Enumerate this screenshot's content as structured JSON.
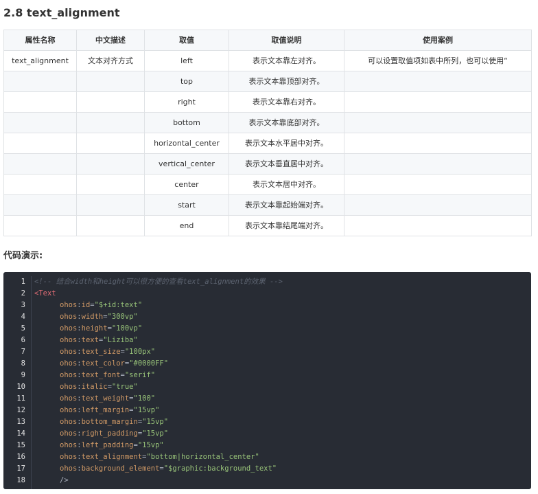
{
  "section_title": "2.8 text_alignment",
  "table": {
    "headers": [
      "属性名称",
      "中文描述",
      "取值",
      "取值说明",
      "使用案例"
    ],
    "rows": [
      [
        "text_alignment",
        "文本对齐方式",
        "left",
        "表示文本靠左对齐。",
        "可以设置取值项如表中所列，也可以使用“"
      ],
      [
        "",
        "",
        "top",
        "表示文本靠顶部对齐。",
        ""
      ],
      [
        "",
        "",
        "right",
        "表示文本靠右对齐。",
        ""
      ],
      [
        "",
        "",
        "bottom",
        "表示文本靠底部对齐。",
        ""
      ],
      [
        "",
        "",
        "horizontal_center",
        "表示文本水平居中对齐。",
        ""
      ],
      [
        "",
        "",
        "vertical_center",
        "表示文本垂直居中对齐。",
        ""
      ],
      [
        "",
        "",
        "center",
        "表示文本居中对齐。",
        ""
      ],
      [
        "",
        "",
        "start",
        "表示文本靠起始端对齐。",
        ""
      ],
      [
        "",
        "",
        "end",
        "表示文本靠结尾端对齐。",
        ""
      ]
    ]
  },
  "code_demo_label": "代码演示:",
  "code": {
    "comment": "<!-- 结合width和height可以很方便的查看text_alignment的效果 -->",
    "open_tag": "<Text",
    "namespace": "ohos",
    "attributes": [
      {
        "name": "id",
        "value": "\"$+id:text\""
      },
      {
        "name": "width",
        "value": "\"300vp\""
      },
      {
        "name": "height",
        "value": "\"100vp\""
      },
      {
        "name": "text",
        "value": "\"Liziba\""
      },
      {
        "name": "text_size",
        "value": "\"100px\""
      },
      {
        "name": "text_color",
        "value": "\"#0000FF\""
      },
      {
        "name": "text_font",
        "value": "\"serif\""
      },
      {
        "name": "italic",
        "value": "\"true\""
      },
      {
        "name": "text_weight",
        "value": "\"100\""
      },
      {
        "name": "left_margin",
        "value": "\"15vp\""
      },
      {
        "name": "bottom_margin",
        "value": "\"15vp\""
      },
      {
        "name": "right_padding",
        "value": "\"15vp\""
      },
      {
        "name": "left_padding",
        "value": "\"15vp\""
      },
      {
        "name": "text_alignment",
        "value": "\"bottom|horizontal_center\""
      },
      {
        "name": "background_element",
        "value": "\"$graphic:background_text\""
      }
    ],
    "close": "/>",
    "line_numbers": [
      "1",
      "2",
      "3",
      "4",
      "5",
      "6",
      "7",
      "8",
      "9",
      "10",
      "11",
      "12",
      "13",
      "14",
      "15",
      "16",
      "17",
      "18"
    ]
  },
  "colors": {
    "code_background": "#282c34",
    "table_stripe": "#f6f8fa",
    "comment": "#5c6370",
    "tag": "#e06c75",
    "attribute": "#d19a66",
    "string": "#98c379"
  }
}
